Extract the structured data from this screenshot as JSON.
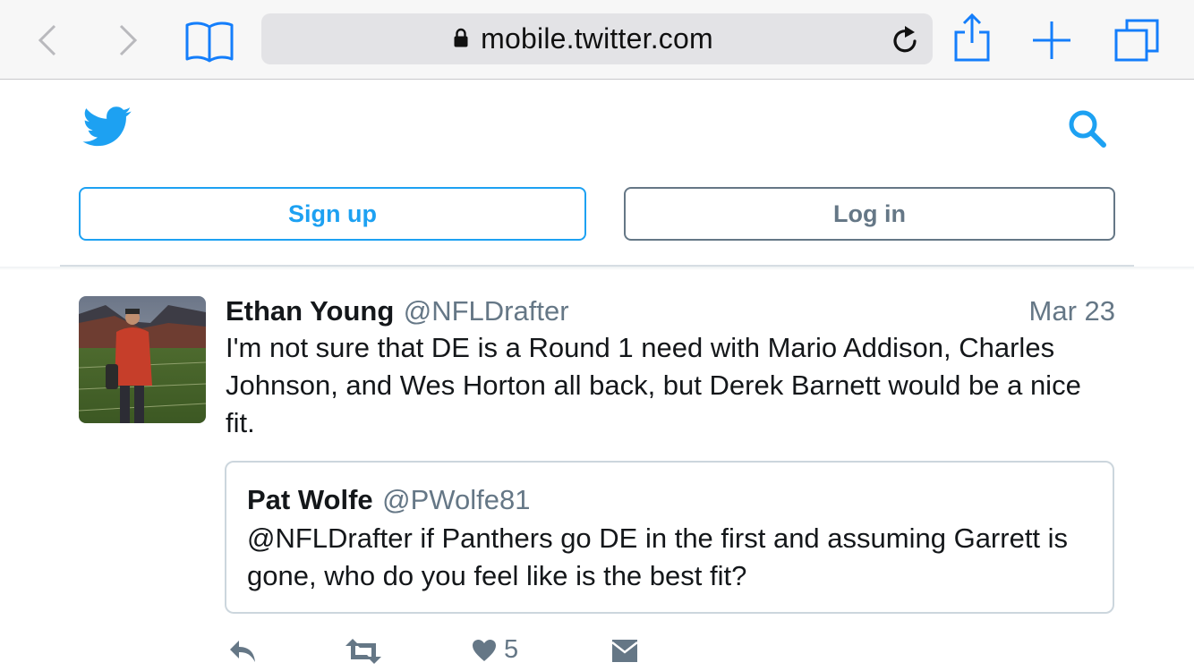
{
  "browser": {
    "url": "mobile.twitter.com",
    "icons": [
      "back-icon",
      "forward-icon",
      "bookmarks-icon",
      "lock-icon",
      "reload-icon",
      "share-icon",
      "new-tab-icon",
      "tabs-icon"
    ],
    "accent": "#147efb"
  },
  "header": {
    "logo": "twitter-bird-icon",
    "search_icon": "search-icon",
    "signup_label": "Sign up",
    "login_label": "Log in",
    "brand_color": "#1da1f2"
  },
  "tweet": {
    "author_name": "Ethan Young",
    "author_handle": "@NFLDrafter",
    "date": "Mar 23",
    "text": "I'm not sure that DE is a Round 1 need with Mario Addison, Charles Johnson, and Wes Horton all back, but Derek Barnett would be a nice fit.",
    "quote": {
      "author_name": "Pat Wolfe",
      "author_handle": "@PWolfe81",
      "text": "@NFLDrafter if Panthers go DE in the first and assuming Garrett is gone, who do you feel like is the best fit?"
    },
    "actions": {
      "reply_icon": "reply-icon",
      "retweet_icon": "retweet-icon",
      "like_icon": "heart-icon",
      "like_count": "5",
      "dm_icon": "direct-message-icon"
    }
  }
}
